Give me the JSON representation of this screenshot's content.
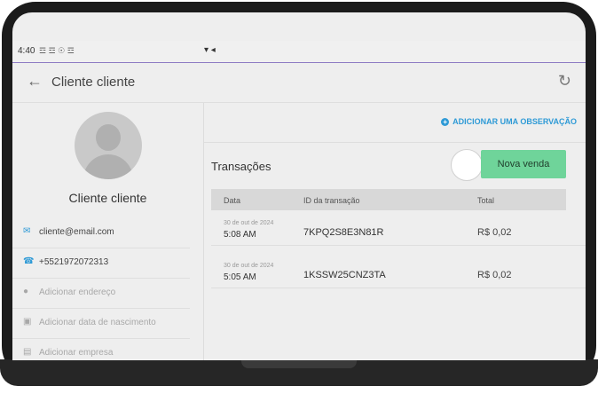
{
  "status_bar": {
    "time": "4:40",
    "left_icons": "☲ ☲ ☉ ☲",
    "right_icons": "▾ ◂"
  },
  "app_bar": {
    "title": "Cliente cliente"
  },
  "client": {
    "name": "Cliente cliente",
    "details": [
      {
        "icon": "email-icon",
        "glyph": "✉",
        "text": "cliente@email.com",
        "color": "#2e9ad6",
        "muted": false
      },
      {
        "icon": "phone-icon",
        "glyph": "☎",
        "text": "+5521972072313",
        "color": "#2e9ad6",
        "muted": false
      },
      {
        "icon": "location-icon",
        "glyph": "●",
        "text": "Adicionar endereço",
        "color": "#a8a8a8",
        "muted": true
      },
      {
        "icon": "cake-icon",
        "glyph": "▣",
        "text": "Adicionar data de nascimento",
        "color": "#a8a8a8",
        "muted": true
      },
      {
        "icon": "company-icon",
        "glyph": "▤",
        "text": "Adicionar empresa",
        "color": "#a8a8a8",
        "muted": true
      }
    ]
  },
  "transactions": {
    "add_note_label": "ADICIONAR UMA OBSERVAÇÃO",
    "title": "Transações",
    "new_sale_label": "Nova venda",
    "columns": {
      "date": "Data",
      "id": "ID da transação",
      "total": "Total"
    },
    "rows": [
      {
        "date_small": "30 de out de 2024",
        "time": "5:08 AM",
        "id": "7KPQ2S8E3N81R",
        "total": "R$ 0,02"
      },
      {
        "date_small": "30 de out de 2024",
        "time": "5:05 AM",
        "id": "1KSSW25CNZ3TA",
        "total": "R$ 0,02"
      }
    ]
  },
  "colors": {
    "accent": "#2e9ad6",
    "new_sale_button": "#6fd49a",
    "status_line": "#8e7cc3"
  }
}
